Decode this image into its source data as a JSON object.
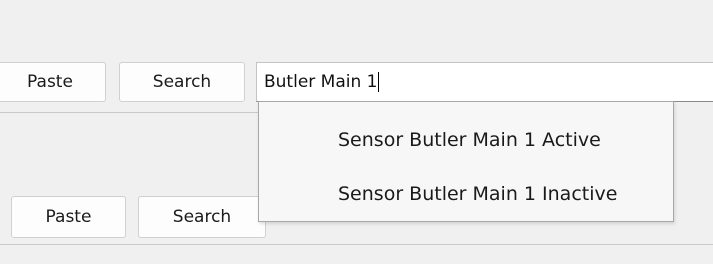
{
  "toolbar_top": {
    "paste_label": "Paste",
    "search_label": "Search"
  },
  "search": {
    "value": "Butler Main 1"
  },
  "dropdown": {
    "items": [
      {
        "label": "Sensor Butler Main 1 Active"
      },
      {
        "label": "Sensor Butler Main 1 Inactive"
      }
    ]
  },
  "toolbar_bottom": {
    "paste_label": "Paste",
    "search_label": "Search"
  }
}
